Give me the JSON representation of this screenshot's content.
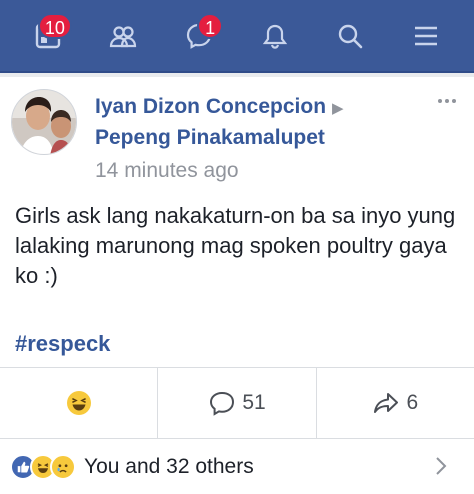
{
  "nav": {
    "notifications_badge": "10",
    "messages_badge": "1"
  },
  "post": {
    "author": "Iyan Dizon Concepcion",
    "group": "Pepeng Pinakamalupet",
    "timestamp": "14 minutes ago",
    "body": "Girls ask lang nakakaturn-on ba sa inyo yung lalaking marunong mag spoken poultry gaya ko :)",
    "hashtag": "#respeck"
  },
  "actions": {
    "comment_count": "51",
    "share_count": "6"
  },
  "reactions": {
    "summary": "You and 32 others",
    "icons": [
      "like-icon",
      "haha-icon",
      "sad-icon"
    ]
  },
  "colors": {
    "nav_bg": "#3b5998",
    "badge": "#e41e3f",
    "link": "#365899"
  }
}
